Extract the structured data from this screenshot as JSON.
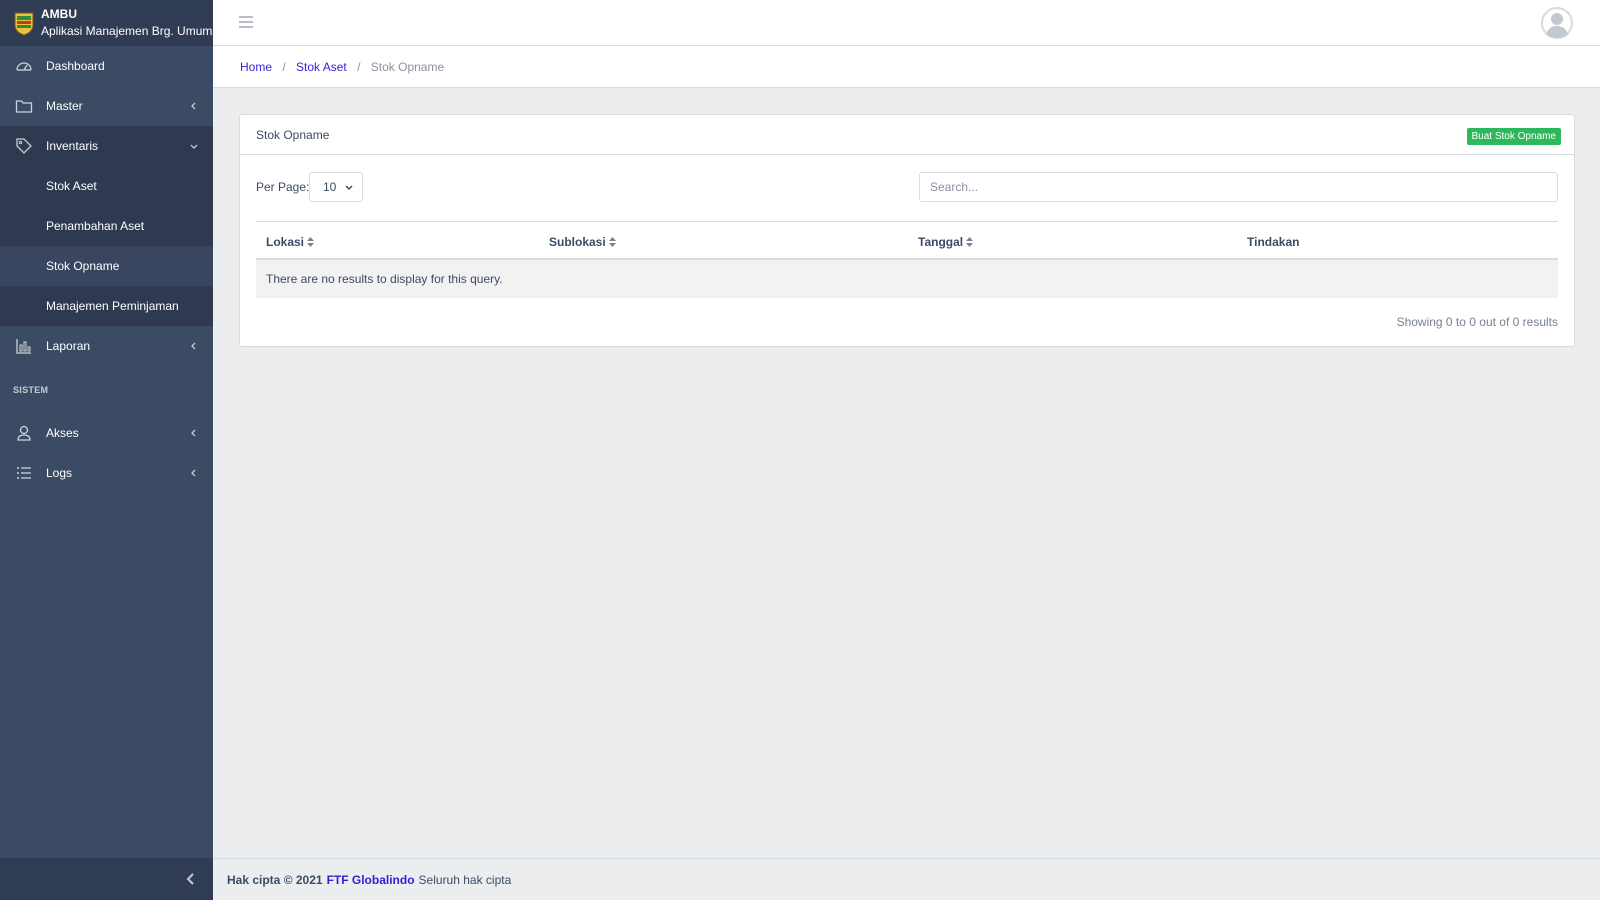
{
  "brand": {
    "name": "AMBU",
    "subtitle": "Aplikasi Manajemen Brg. Umum"
  },
  "sidebar": {
    "items": [
      {
        "label": "Dashboard",
        "icon": "speedometer-icon"
      },
      {
        "label": "Master",
        "icon": "folder-icon"
      },
      {
        "label": "Inventaris",
        "icon": "tag-icon",
        "children": [
          "Stok Aset",
          "Penambahan Aset",
          "Stok Opname",
          "Manajemen Peminjaman"
        ]
      },
      {
        "label": "Laporan",
        "icon": "bar-chart-icon"
      }
    ],
    "section_title": "SISTEM",
    "system_items": [
      {
        "label": "Akses",
        "icon": "user-icon"
      },
      {
        "label": "Logs",
        "icon": "list-icon"
      }
    ]
  },
  "breadcrumb": {
    "home": "Home",
    "parent": "Stok Aset",
    "current": "Stok Opname",
    "separator": "/"
  },
  "card": {
    "title": "Stok Opname",
    "create_button": "Buat Stok Opname",
    "per_page_label": "Per Page:",
    "per_page_value": "10",
    "search_placeholder": "Search...",
    "columns": [
      "Lokasi",
      "Sublokasi",
      "Tanggal",
      "Tindakan"
    ],
    "empty_message": "There are no results to display for this query.",
    "showing": "Showing 0 to 0 out of 0 results"
  },
  "footer": {
    "copyright": "Hak cipta © 2021",
    "company": "FTF Globalindo",
    "rights": "Seluruh hak cipta"
  },
  "colors": {
    "sidebar": "#3c4b64",
    "brand_bar": "#303c54",
    "accent": "#321fdb",
    "success": "#2eb85c"
  }
}
